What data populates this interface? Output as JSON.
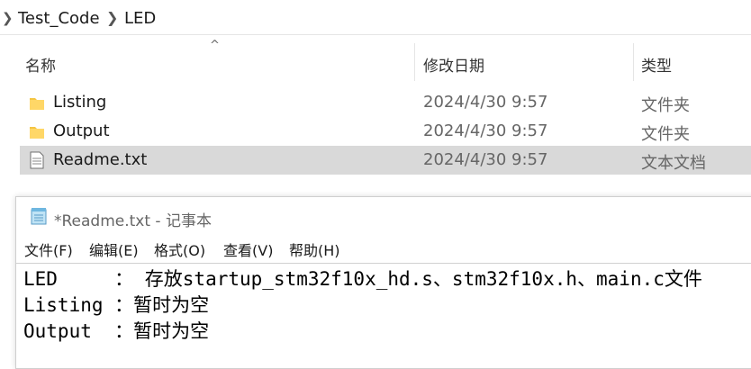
{
  "breadcrumb": {
    "items": [
      "Test_Code",
      "LED"
    ]
  },
  "columns": {
    "name": "名称",
    "date_modified": "修改日期",
    "type": "类型"
  },
  "files": [
    {
      "name": "Listing",
      "date": "2024/4/30 9:57",
      "type": "文件夹",
      "icon": "folder-icon",
      "selected": false
    },
    {
      "name": "Output",
      "date": "2024/4/30 9:57",
      "type": "文件夹",
      "icon": "folder-icon",
      "selected": false
    },
    {
      "name": "Readme.txt",
      "date": "2024/4/30 9:57",
      "type": "文本文档",
      "icon": "text-file-icon",
      "selected": true
    }
  ],
  "notepad": {
    "title": "*Readme.txt - 记事本",
    "menu": [
      "文件(F)",
      "编辑(E)",
      "格式(O)",
      "查看(V)",
      "帮助(H)"
    ],
    "lines": [
      "LED     ： 存放startup_stm32f10x_hd.s、stm32f10x.h、main.c文件",
      "Listing ：暂时为空",
      "Output  ：暂时为空"
    ]
  },
  "colors": {
    "selection": "#d9d9d9",
    "folder": "#f5c542",
    "secondary_text": "#666666"
  }
}
